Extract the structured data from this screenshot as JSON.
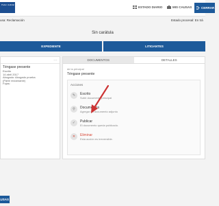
{
  "header": {
    "logo_text": "Poder Judicial",
    "estado_diario": "ESTADO DIARIO",
    "mis_causas": "MIS CAUSAS",
    "cerrar": "CERRAR"
  },
  "subheader": {
    "left": "usa: Reclamación",
    "right": "Estado procesal: En trá"
  },
  "case_title": "Sin carátula",
  "tabs": {
    "expediente": "EXPEDIENTE",
    "litigantes": "LITIGANTES"
  },
  "left_panel": {
    "menu": "...",
    "entry": {
      "title": "Téngase presente",
      "lines": [
        "Escrito",
        "14 abril 2017",
        "Abogado: Abogado prueba",
        "(Parte reclamante)",
        "Fojas:"
      ]
    }
  },
  "right_panel": {
    "tabs": {
      "documentos": "DOCUMENTOS",
      "detalles": "DETALLES"
    },
    "principal_label": "de la principal",
    "principal_title": "Téngase presente",
    "acciones_label": "Acciones",
    "actions": [
      {
        "title": "Escrito",
        "desc": "Subir documento principal",
        "icon": "pen-icon",
        "glyph": "✎"
      },
      {
        "title": "Documentos",
        "desc": "Agregar un documento adjunto",
        "icon": "paperclip-icon",
        "glyph": "⚲"
      },
      {
        "title": "Publicar",
        "desc": "El documento queda publicado.",
        "icon": "check-icon",
        "glyph": "✓"
      },
      {
        "title": "Eliminar",
        "desc": "Esta acción es irreversible.",
        "icon": "trash-icon",
        "glyph": "✕"
      }
    ]
  },
  "footer": {
    "causas_btn": "CAUSAS"
  },
  "colors": {
    "primary": "#1d5a9a",
    "danger": "#d84a3a",
    "annotation_arrow": "#cc3333"
  }
}
